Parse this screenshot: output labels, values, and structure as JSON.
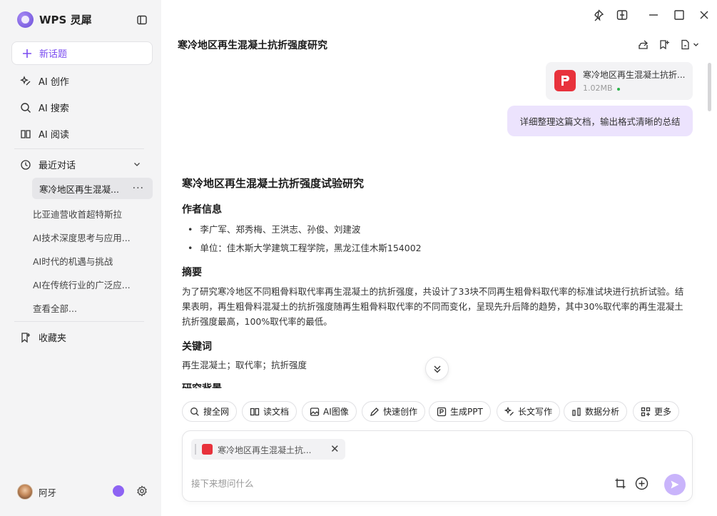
{
  "sidebar": {
    "brand": "WPS 灵犀",
    "new_topic": "新话题",
    "nav": [
      {
        "label": "AI 创作",
        "icon": "sparkle-pen-icon"
      },
      {
        "label": "AI 搜索",
        "icon": "search-sparkle-icon"
      },
      {
        "label": "AI 阅读",
        "icon": "book-icon"
      }
    ],
    "recent_label": "最近对话",
    "history": [
      "寒冷地区再生混凝...",
      "比亚迪营收首超特斯拉",
      "AI技术深度思考与应用...",
      "AI时代的机遇与挑战",
      "AI在传统行业的广泛应...",
      "查看全部..."
    ],
    "favorites": "收藏夹",
    "user_name": "阿牙"
  },
  "header": {
    "title": "寒冷地区再生混凝土抗折强度研究"
  },
  "conversation": {
    "file": {
      "name": "寒冷地区再生混凝土抗折...",
      "size": "1.02MB"
    },
    "user_message": "详细整理这篇文档，输出格式清晰的总结",
    "answer": {
      "title": "寒冷地区再生混凝土抗折强度试验研究",
      "author_heading": "作者信息",
      "authors": "李广军、郑秀梅、王洪志、孙俊、刘建波",
      "affiliation": "单位：佳木斯大学建筑工程学院，黑龙江佳木斯154002",
      "abstract_heading": "摘要",
      "abstract": "为了研究寒冷地区不同粗骨料取代率再生混凝土的抗折强度，共设计了33块不同再生粗骨料取代率的标准试块进行抗折试验。结果表明，再生粗骨料混凝土的抗折强度随再生粗骨料取代率的不同而变化，呈现先升后降的趋势，其中30%取代率的再生混凝土抗折强度最高，100%取代率的最低。",
      "keywords_heading": "关键词",
      "keywords": "再生混凝土；取代率；抗折强度",
      "next_heading": "研究背景"
    }
  },
  "tools": [
    "搜全网",
    "读文档",
    "AI图像",
    "快速创作",
    "生成PPT",
    "长文写作",
    "数据分析",
    "更多"
  ],
  "composer": {
    "attachment": "寒冷地区再生混凝土抗...",
    "placeholder": "接下来想问什么"
  },
  "colors": {
    "accent": "#7b4cf0",
    "user_bubble": "#ece3fd",
    "pdf_red": "#e8323c",
    "send": "#c9b4fb"
  }
}
